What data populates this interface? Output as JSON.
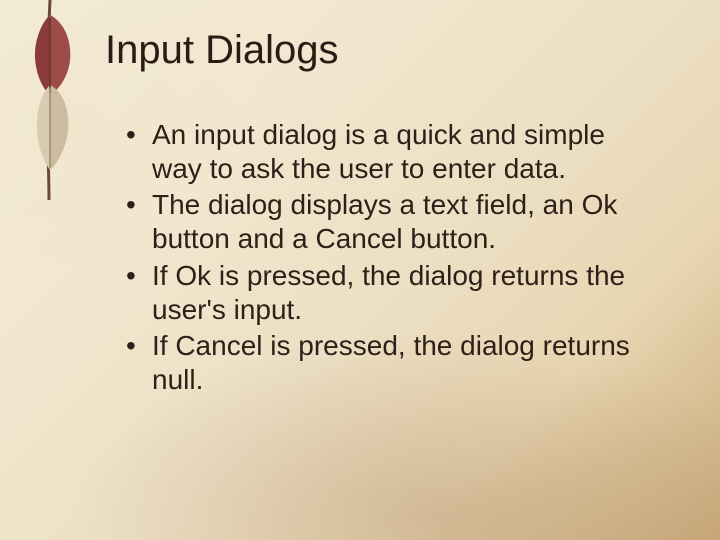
{
  "slide": {
    "title": "Input Dialogs",
    "bullets": [
      "An input dialog is a quick and simple way to ask the user to enter data.",
      "The dialog displays a text field, an Ok button and a Cancel button.",
      "If Ok is pressed, the dialog returns the user's input.",
      "If Cancel is pressed, the dialog returns null."
    ]
  }
}
